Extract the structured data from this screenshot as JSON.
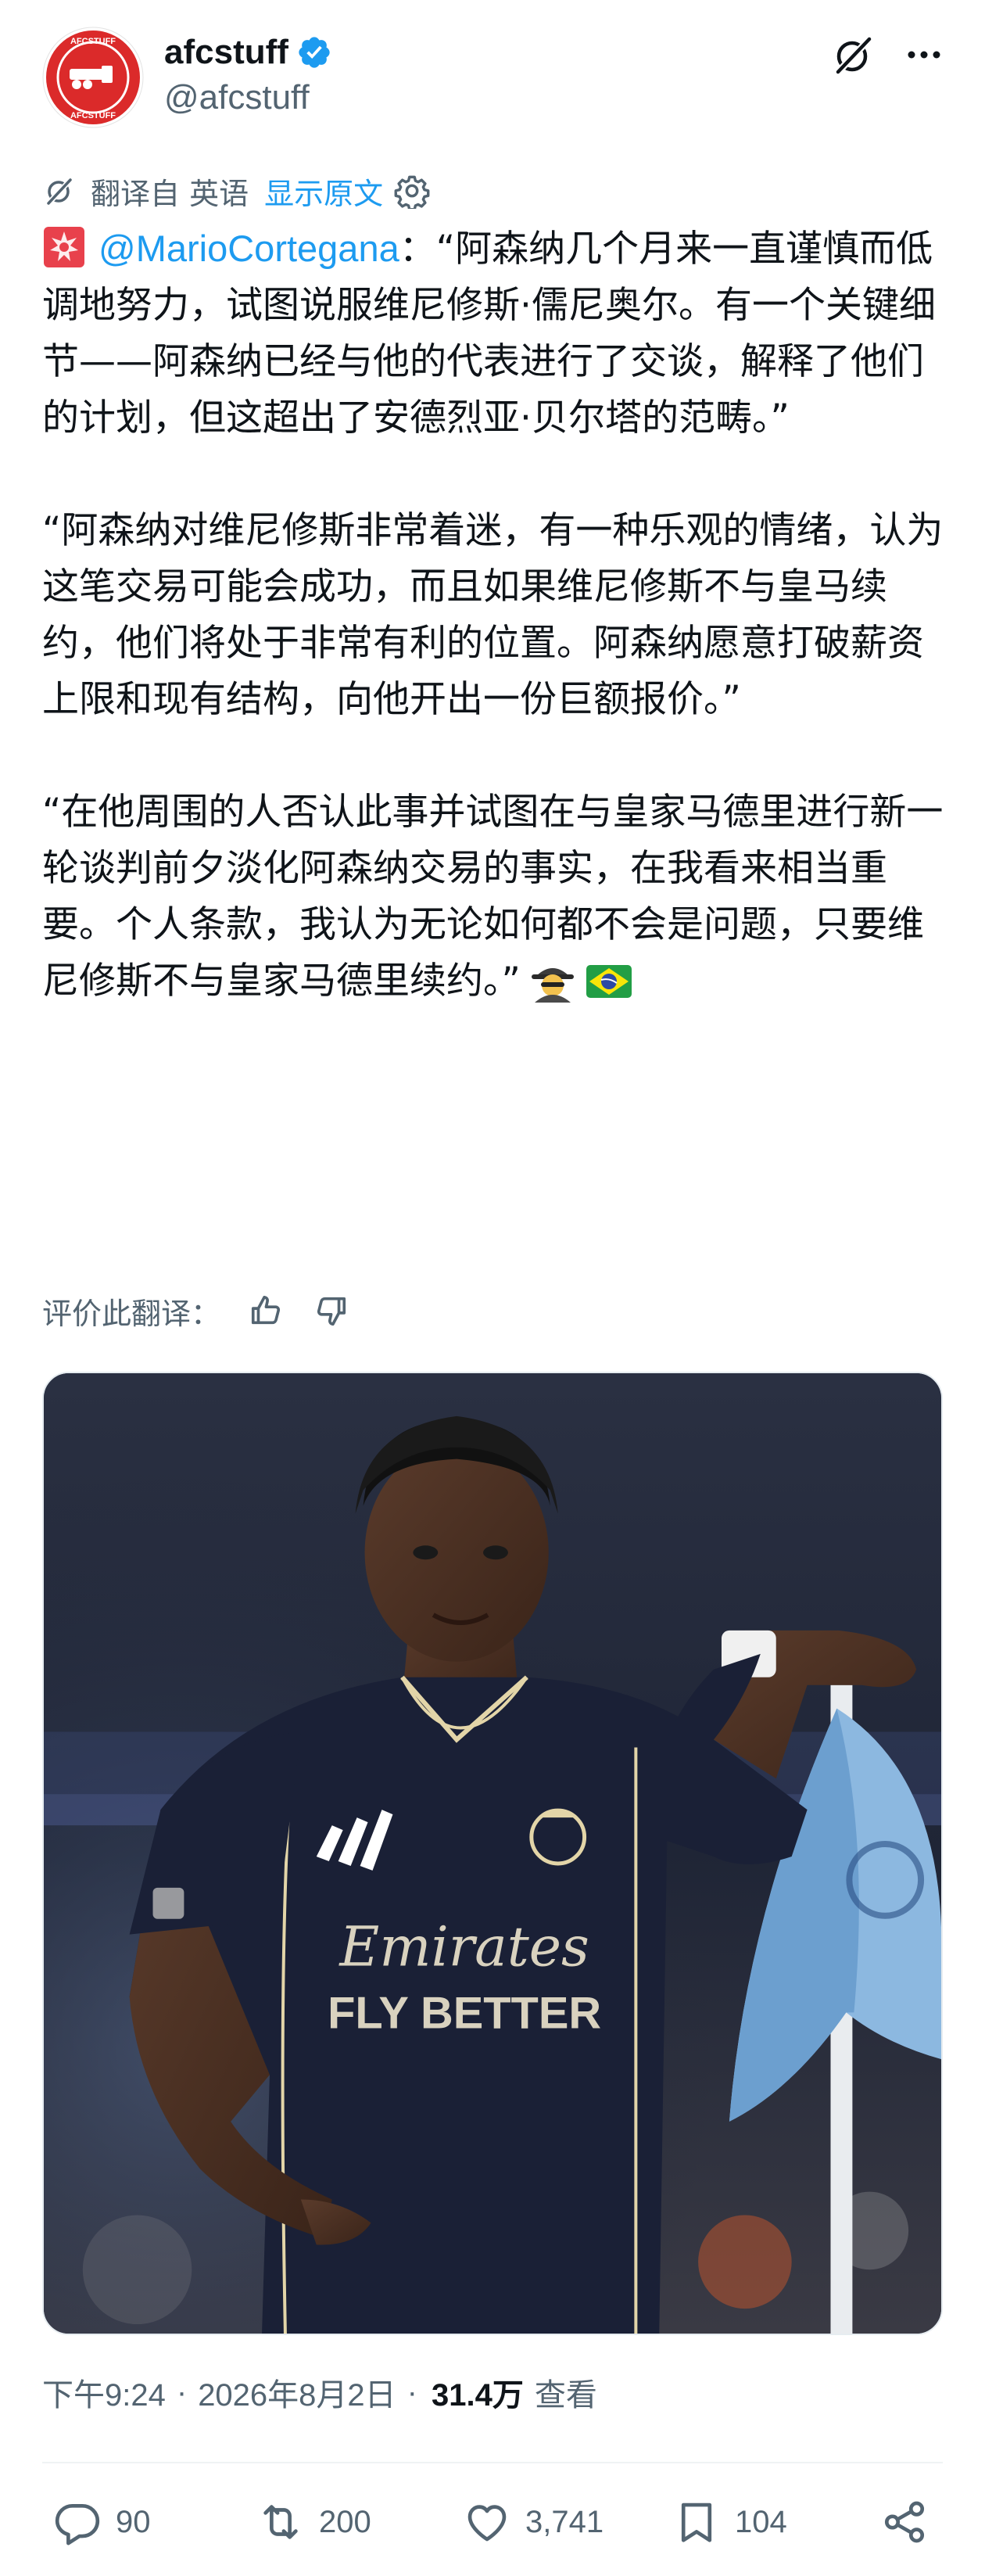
{
  "author": {
    "avatar_text_top": "AFCSTUFF",
    "avatar_text_bottom": "AFCSTUFF",
    "name": "afcstuff",
    "handle": "@afcstuff"
  },
  "translation_bar": {
    "label": "翻译自 英语",
    "show_original": "显示原文"
  },
  "tweet": {
    "mention": "@MarioCortegana",
    "p1_after_mention": "：“阿森纳几个月来一直谨慎而低调地努力，试图说服维尼修斯·儒尼奥尔。有一个关键细节——阿森纳已经与他的代表进行了交谈，解释了他们的计划，但这超出了安德烈亚·贝尔塔的范畴。”",
    "p2": "“阿森纳对维尼修斯非常着迷，有一种乐观的情绪，认为这笔交易可能会成功，而且如果维尼修斯不与皇马续约，他们将处于非常有利的位置。阿森纳愿意打破薪资上限和现有结构，向他开出一份巨额报价。”",
    "p3": "“在他周围的人否认此事并试图在与皇家马德里进行新一轮谈判前夕淡化阿森纳交易的事实，在我看来相当重要。个人条款，我认为无论如何都不会是问题，只要维尼修斯不与皇家马德里续约。”"
  },
  "rate_translation": {
    "label": "评价此翻译："
  },
  "media": {
    "shirt_sponsor_top": "Emirates",
    "shirt_sponsor_bottom": "FLY BETTER"
  },
  "meta": {
    "time": "下午9:24",
    "date": "2026年8月2日",
    "separator": "·",
    "views_count": "31.4万",
    "views_label": "查看"
  },
  "actions": {
    "replies": "90",
    "retweets": "200",
    "likes": "3,741",
    "bookmarks": "104"
  },
  "colors": {
    "accent": "#1d9bf0",
    "secondary_text": "#536471",
    "primary_text": "#0f1419",
    "avatar_red": "#db2a2a"
  }
}
